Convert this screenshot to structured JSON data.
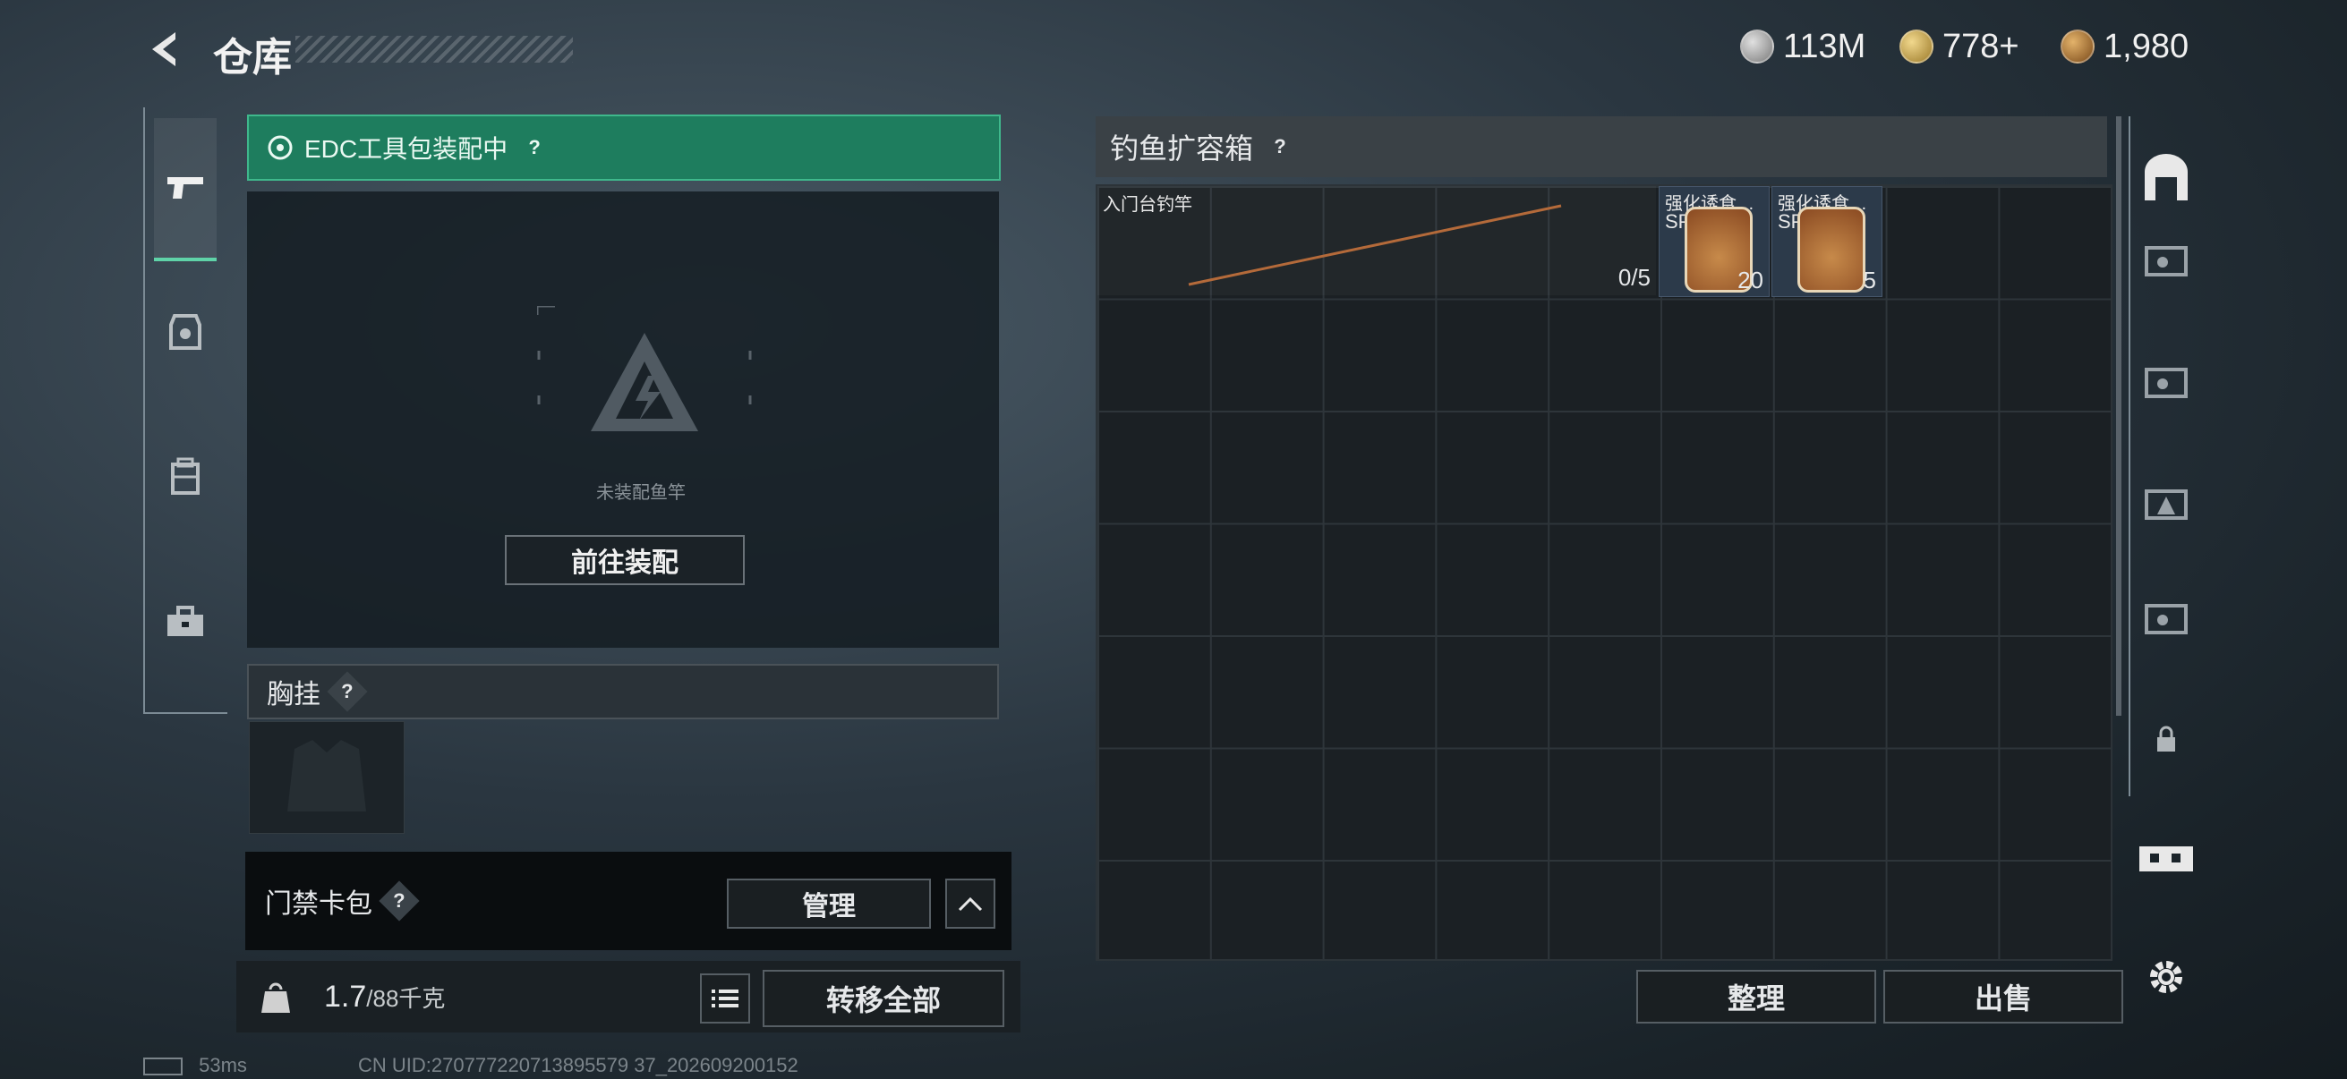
{
  "header": {
    "title": "仓库"
  },
  "currencies": [
    {
      "icon": "silver-coin-icon",
      "value": "113M"
    },
    {
      "icon": "gold-token-icon",
      "value": "778+"
    },
    {
      "icon": "bronze-coin-icon",
      "value": "1,980"
    }
  ],
  "left": {
    "equip_status": "EDC工具包装配中",
    "not_equipped": "未装配鱼竿",
    "goto_equip": "前往装配",
    "chest_title": "胸挂",
    "card_pack_title": "门禁卡包",
    "manage": "管理",
    "weight_value": "1.7",
    "weight_limit": "/88千克",
    "transfer_all": "转移全部"
  },
  "right": {
    "container_title": "钓鱼扩容箱",
    "rod_name": "入门台钓竿",
    "rod_count": "0/5",
    "items": [
      {
        "name": "强化诱食…",
        "grade": "SP",
        "count": "20"
      },
      {
        "name": "强化诱食…",
        "grade": "SP",
        "count": "5"
      }
    ],
    "sort": "整理",
    "sell": "出售"
  },
  "status_bar": {
    "ping": "53ms",
    "uid": "CN UID:270777220713895579 37_202609200152"
  },
  "colors": {
    "accent_green": "#1e7d5e",
    "accent_bar": "#5fd3a8"
  }
}
